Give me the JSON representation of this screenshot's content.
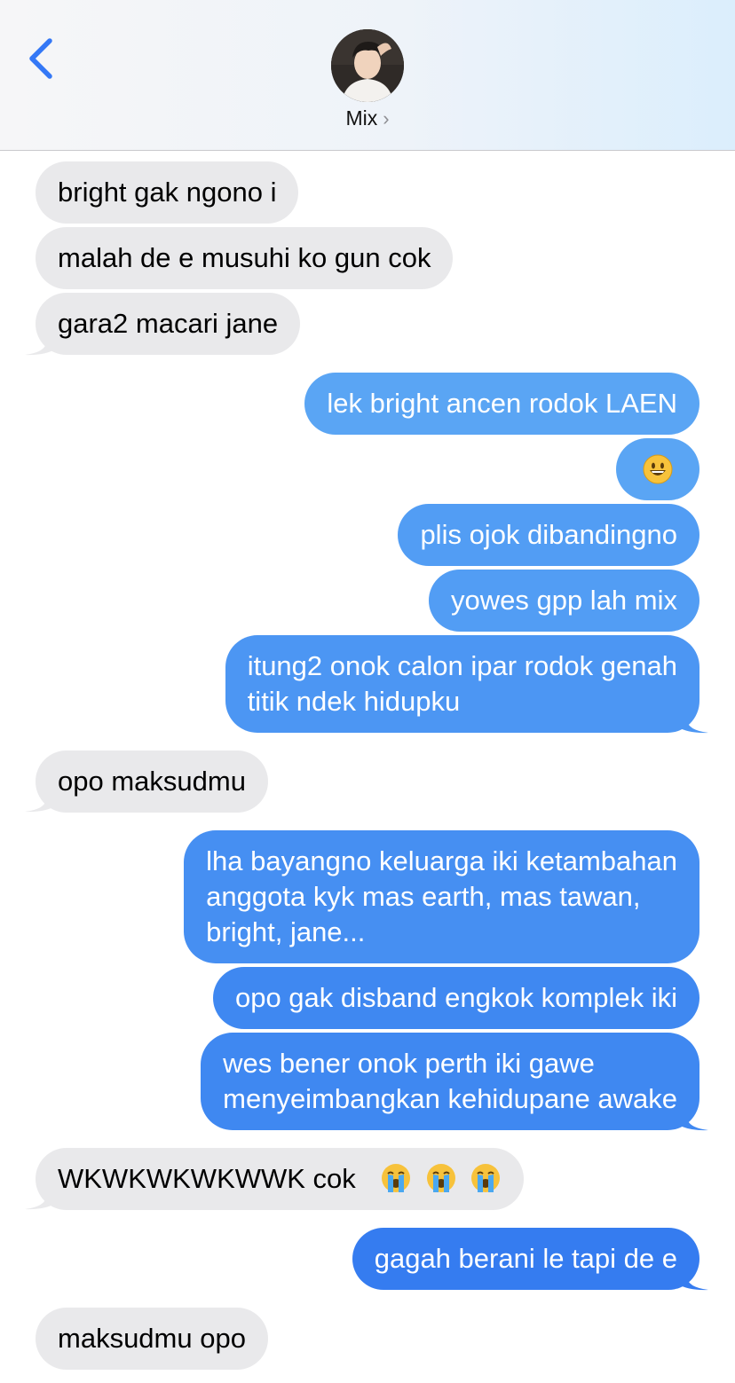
{
  "header": {
    "contact_name": "Mix",
    "back_icon": "chevron-left-icon",
    "chevron_icon": "chevron-right-icon",
    "accent": "#3478f6"
  },
  "colors": {
    "incoming_bubble": "#e9e9eb",
    "outgoing_bubble_top": "#5aa5f4",
    "outgoing_bubble_bottom": "#357cf0"
  },
  "messages": [
    {
      "dir": "in",
      "text": "bright gak ngono i"
    },
    {
      "dir": "in",
      "text": "malah de e musuhi ko gun cok"
    },
    {
      "dir": "in",
      "text": "gara2 macari jane"
    },
    {
      "dir": "out",
      "text": "lek bright ancen rodok LAEN"
    },
    {
      "dir": "out",
      "emoji": "grinning-face-emoji"
    },
    {
      "dir": "out",
      "text": "plis ojok dibandingno"
    },
    {
      "dir": "out",
      "text": "yowes gpp lah mix"
    },
    {
      "dir": "out",
      "lines": [
        "itung2 onok calon ipar rodok genah",
        "titik ndek hidupku"
      ]
    },
    {
      "dir": "in",
      "text": "opo maksudmu"
    },
    {
      "dir": "out",
      "lines": [
        "lha bayangno keluarga iki ketambahan",
        "anggota kyk mas earth, mas tawan,",
        "bright, jane..."
      ]
    },
    {
      "dir": "out",
      "text": "opo gak disband engkok komplek iki"
    },
    {
      "dir": "out",
      "lines": [
        "wes bener onok perth iki gawe",
        "menyeimbangkan kehidupane awake"
      ]
    },
    {
      "dir": "in",
      "text": "WKWKWKWKWWK cok",
      "emoji": "loudly-crying-face-emoji ×3"
    },
    {
      "dir": "out",
      "text": "gagah berani le tapi de e"
    },
    {
      "dir": "in",
      "text": "maksudmu opo"
    }
  ]
}
